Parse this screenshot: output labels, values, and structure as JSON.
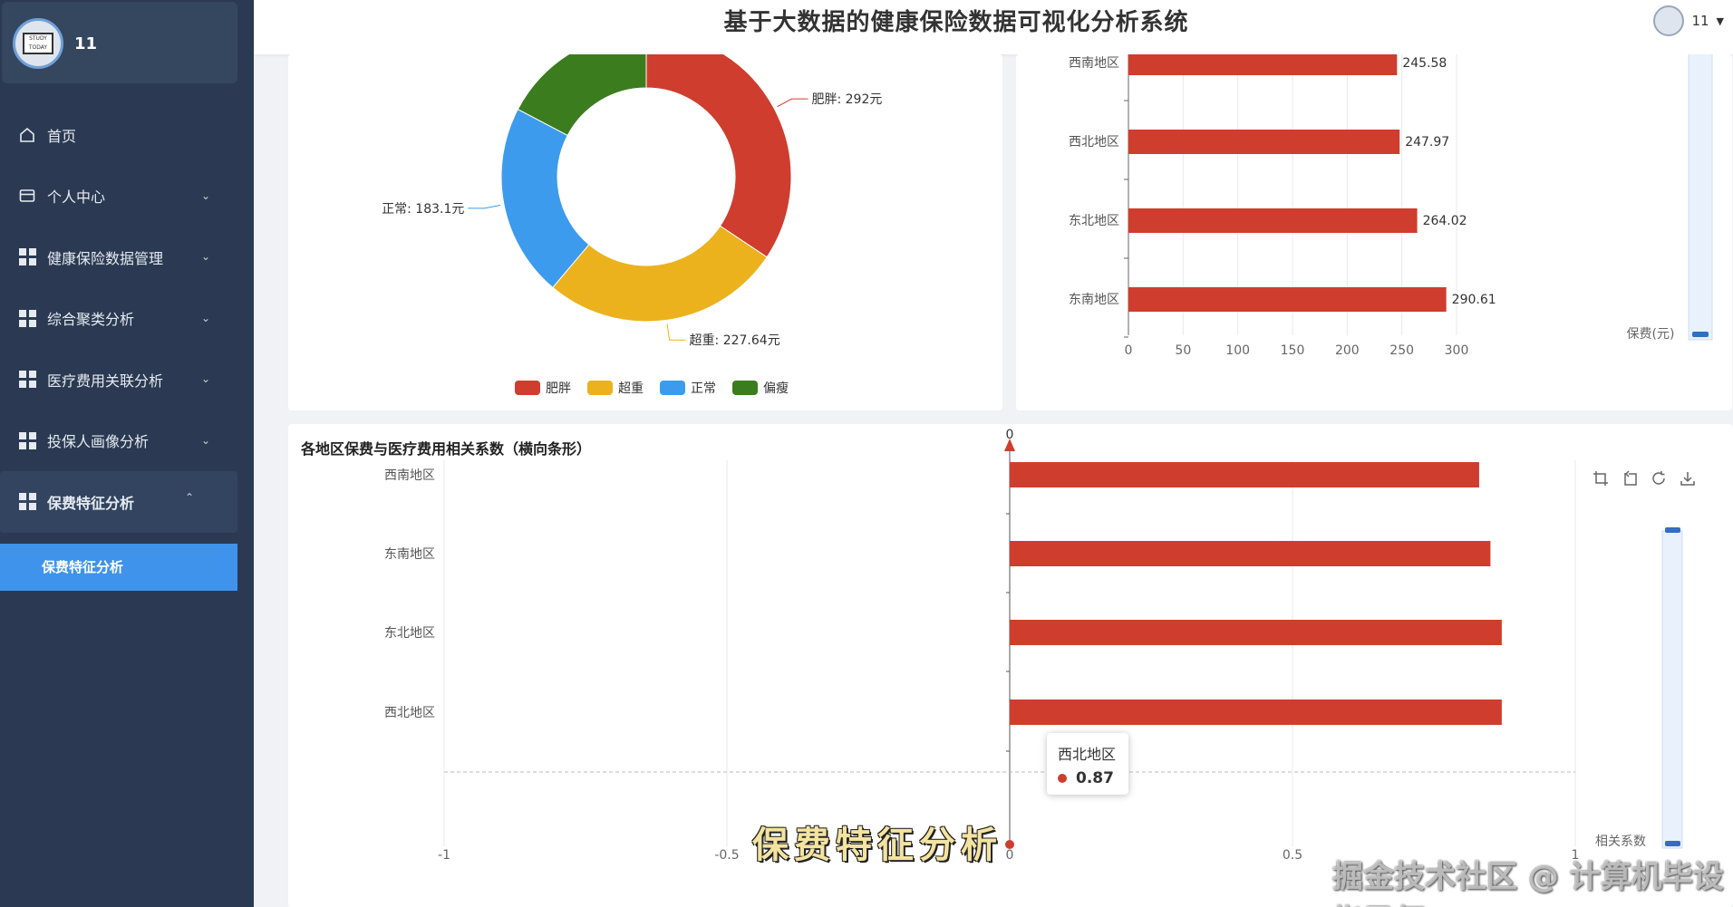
{
  "sidebar": {
    "username": "11",
    "items": [
      {
        "label": "首页"
      },
      {
        "label": "个人中心"
      },
      {
        "label": "健康保险数据管理"
      },
      {
        "label": "综合聚类分析"
      },
      {
        "label": "医疗费用关联分析"
      },
      {
        "label": "投保人画像分析"
      },
      {
        "label": "保费特征分析"
      }
    ],
    "submenu_label": "保费特征分析"
  },
  "header": {
    "title": "基于大数据的健康保险数据可视化分析系统",
    "user": "11"
  },
  "bottom_panel": {
    "title": "各地区保费与医疗费用相关系数（横向条形）"
  },
  "tooltip": {
    "title": "西北地区",
    "value": "0.87"
  },
  "caption": "保费特征分析",
  "watermark": "掘金技术社区 @ 计算机毕设指导师",
  "colors": {
    "red": "#cf3d2e",
    "yellow": "#ecb21d",
    "blue": "#3d9bee",
    "green": "#3b7d1e",
    "sidebar": "#2b3a52",
    "accent": "#3f93ea"
  },
  "chart_data": [
    {
      "type": "pie",
      "subtype": "donut",
      "slices": [
        {
          "name": "肥胖",
          "value": 292,
          "label": "肥胖: 292元"
        },
        {
          "name": "超重",
          "value": 227.64,
          "label": "超重: 227.64元"
        },
        {
          "name": "正常",
          "value": 183.1,
          "label": "正常: 183.1元"
        },
        {
          "name": "偏瘦",
          "value": 147,
          "label": ""
        }
      ],
      "legend": [
        "肥胖",
        "超重",
        "正常",
        "偏瘦"
      ],
      "legend_position": "bottom"
    },
    {
      "type": "bar",
      "orientation": "horizontal",
      "categories": [
        "西南地区",
        "西北地区",
        "东北地区",
        "东南地区"
      ],
      "values": [
        245.58,
        247.97,
        264.02,
        290.61
      ],
      "xlabel": "保费(元)",
      "xlim": [
        0,
        300
      ],
      "xticks": [
        "0",
        "50",
        "100",
        "150",
        "200",
        "250",
        "300"
      ]
    },
    {
      "type": "bar",
      "orientation": "horizontal",
      "title": "各地区保费与医疗费用相关系数（横向条形）",
      "categories": [
        "西南地区",
        "东南地区",
        "东北地区",
        "西北地区"
      ],
      "values": [
        0.83,
        0.85,
        0.87,
        0.87
      ],
      "xlabel": "相关系数",
      "xlim": [
        -1,
        1
      ],
      "xticks": [
        "-1",
        "-0.5",
        "0",
        "0.5",
        "1"
      ],
      "y_axis_label_top": "0"
    }
  ]
}
